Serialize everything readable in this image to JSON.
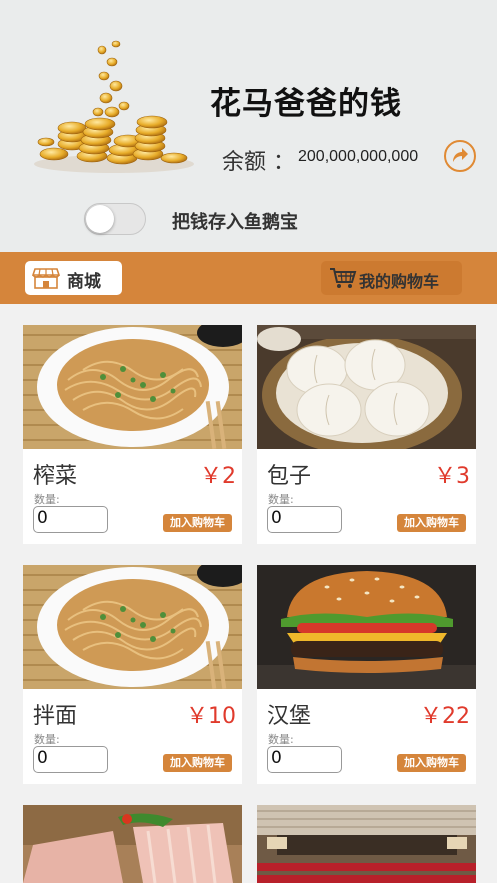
{
  "header": {
    "title": "花马爸爸的钱",
    "balance_label": "余额 ：",
    "balance_value": "200,000,000,000",
    "toggle_label": "把钱存入鱼鹅宝",
    "accent_color": "#d5853b"
  },
  "nav": {
    "mall_label": "商城",
    "cart_label": "我的购物车"
  },
  "products": [
    {
      "name": "榨菜",
      "price": "￥2",
      "qty_label": "数量:",
      "qty": "0",
      "add_label": "加入购物车",
      "image": "noodles-photo"
    },
    {
      "name": "包子",
      "price": "￥3",
      "qty_label": "数量:",
      "qty": "0",
      "add_label": "加入购物车",
      "image": "buns-photo"
    },
    {
      "name": "拌面",
      "price": "￥10",
      "qty_label": "数量:",
      "qty": "0",
      "add_label": "加入购物车",
      "image": "noodles-photo"
    },
    {
      "name": "汉堡",
      "price": "￥22",
      "qty_label": "数量:",
      "qty": "0",
      "add_label": "加入购物车",
      "image": "burger-photo"
    }
  ]
}
